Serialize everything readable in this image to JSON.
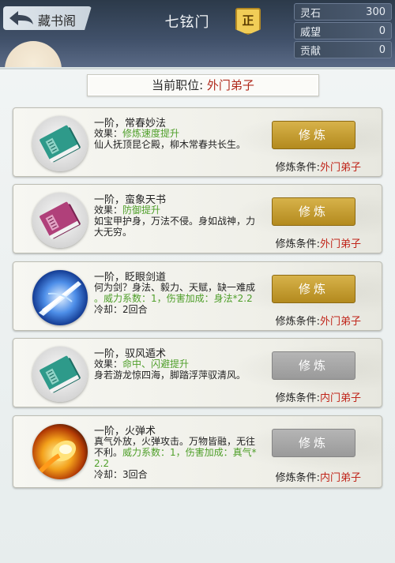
{
  "header": {
    "back_label": "藏书阁",
    "title": "七铉门",
    "badge": "正",
    "stats": [
      {
        "label": "灵石",
        "value": "300"
      },
      {
        "label": "威望",
        "value": "0"
      },
      {
        "label": "贡献",
        "value": "0"
      }
    ]
  },
  "rank": {
    "label": "当前职位:",
    "value": "外门弟子"
  },
  "cond_label": "修炼条件:",
  "techniques": [
    {
      "name": "一阶，常春妙法",
      "lines": [
        [
          {
            "t": "效果：",
            "c": ""
          },
          {
            "t": "修炼速度提升",
            "c": "green"
          }
        ],
        [
          {
            "t": "仙人抚顶昆仑殿，柳木常春共长生。",
            "c": ""
          }
        ]
      ],
      "button": "修炼",
      "enabled": true,
      "condition": "外门弟子",
      "icon": "teal-book-icon"
    },
    {
      "name": "一阶，蛮象天书",
      "lines": [
        [
          {
            "t": "效果：",
            "c": ""
          },
          {
            "t": "防御提升",
            "c": "green"
          }
        ],
        [
          {
            "t": "如宝甲护身，万法不侵。身如战神，力",
            "c": ""
          }
        ],
        [
          {
            "t": "大无穷。",
            "c": ""
          }
        ]
      ],
      "button": "修炼",
      "enabled": true,
      "condition": "外门弟子",
      "icon": "purple-book-icon"
    },
    {
      "name": "一阶，眨眼剑道",
      "lines": [
        [
          {
            "t": "何为剑？身法、毅力、天赋，缺一难成",
            "c": ""
          }
        ],
        [
          {
            "t": "。威力系数：1，伤害加成：身法*2.2",
            "c": "green"
          }
        ],
        [
          {
            "t": "冷却：2回合",
            "c": ""
          }
        ]
      ],
      "button": "修炼",
      "enabled": true,
      "condition": "外门弟子",
      "icon": "sword-slash-icon"
    },
    {
      "name": "一阶，驭风遁术",
      "lines": [
        [
          {
            "t": "效果：",
            "c": ""
          },
          {
            "t": "命中、闪避提升",
            "c": "green"
          }
        ],
        [
          {
            "t": "身若游龙惊四海，脚踏浮萍驭清风。",
            "c": ""
          }
        ]
      ],
      "button": "修炼",
      "enabled": false,
      "condition": "内门弟子",
      "icon": "teal-book-icon"
    },
    {
      "name": "一阶，火弹术",
      "lines": [
        [
          {
            "t": "真气外放，火弹攻击。万物皆融，无往",
            "c": ""
          }
        ],
        [
          {
            "t": "不利。",
            "c": ""
          },
          {
            "t": "威力系数：1，伤害加成：真气*",
            "c": "green"
          }
        ],
        [
          {
            "t": "2.2",
            "c": "green"
          }
        ],
        [
          {
            "t": "冷却：3回合",
            "c": ""
          }
        ]
      ],
      "button": "修炼",
      "enabled": false,
      "condition": "内门弟子",
      "icon": "fireball-icon"
    }
  ],
  "colors": {
    "accent_red": "#c0251a",
    "effect_green": "#4f9f2a",
    "button_gold": "#c7a03a",
    "button_gray": "#a8a8a8"
  }
}
